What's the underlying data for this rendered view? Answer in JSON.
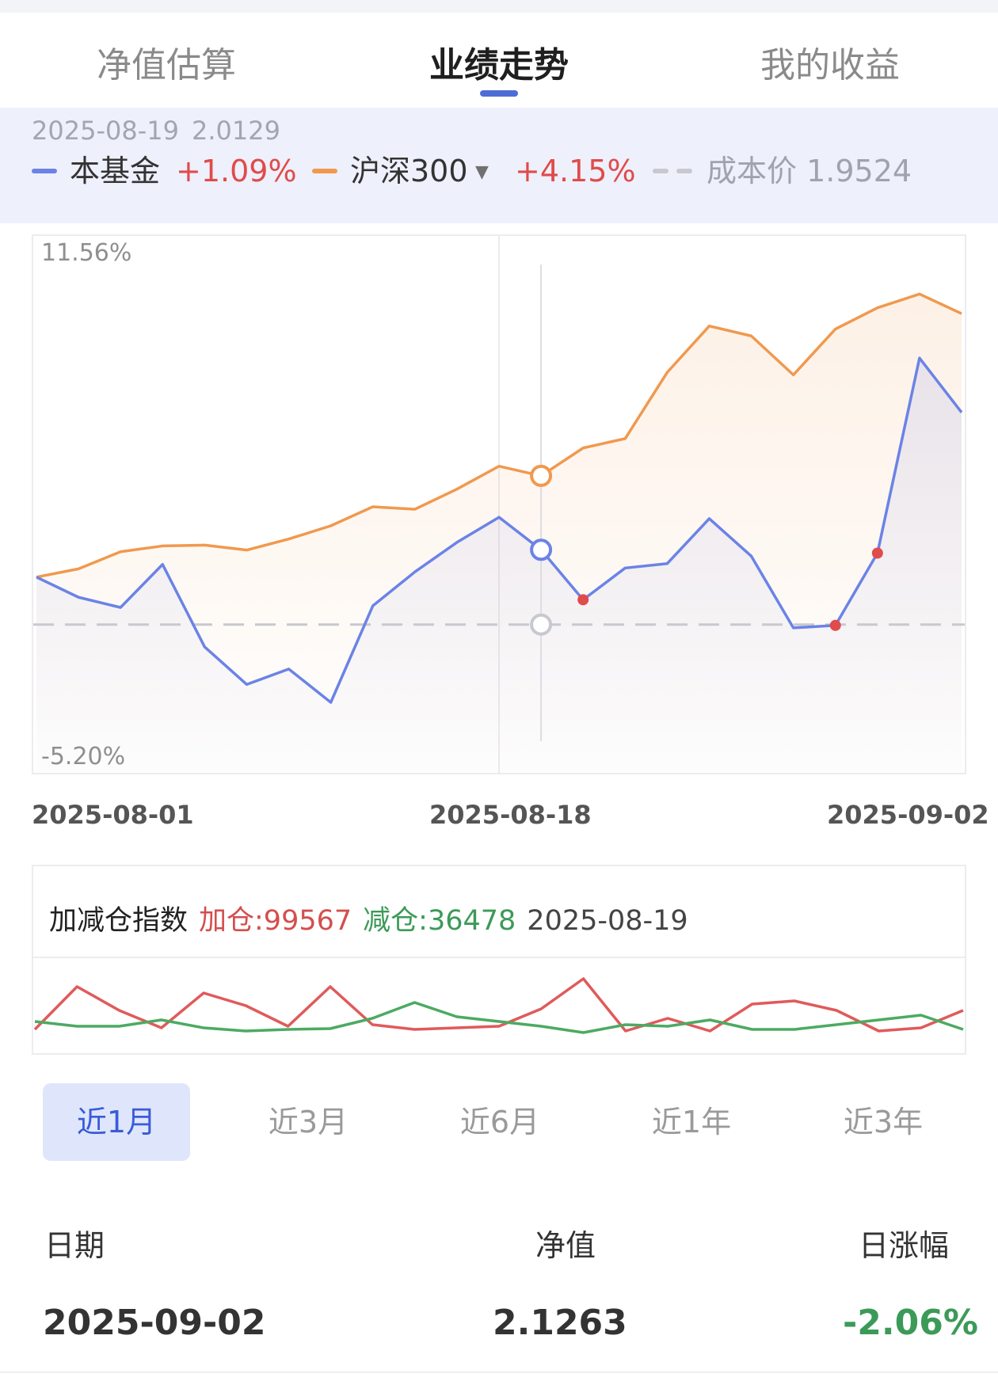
{
  "tabs": [
    {
      "label": "净值估算"
    },
    {
      "label": "业绩走势",
      "active": true
    },
    {
      "label": "我的收益"
    }
  ],
  "legend": {
    "date": "2025-08-19",
    "nav": "2.0129",
    "fund_label": "本基金",
    "fund_change": "+1.09%",
    "index_label": "沪深300",
    "index_change": "+4.15%",
    "cost_label": "成本价 1.9524",
    "colors": {
      "fund": "#6b83e6",
      "index": "#f0994e",
      "cost": "#c8c8d0",
      "positive": "#e04b4b",
      "negative": "#3c9a58"
    }
  },
  "chart_data": [
    {
      "type": "line",
      "ylim": [
        -5.2,
        11.56
      ],
      "y_tick_labels": [
        "11.56%",
        "-5.20%"
      ],
      "x_tick_labels": [
        "2025-08-01",
        "2025-08-18",
        "2025-09-02"
      ],
      "x": [
        "08-01",
        "08-04",
        "08-05",
        "08-06",
        "08-07",
        "08-08",
        "08-11",
        "08-12",
        "08-13",
        "08-14",
        "08-15",
        "08-18",
        "08-19",
        "08-20",
        "08-21",
        "08-22",
        "08-25",
        "08-26",
        "08-27",
        "08-28",
        "08-29",
        "09-01",
        "09-02"
      ],
      "series": [
        {
          "name": "本基金",
          "color": "#6b83e6",
          "values": [
            0.0,
            -0.73,
            -1.1,
            0.46,
            -2.53,
            -3.89,
            -3.33,
            -4.54,
            -1.04,
            0.19,
            1.26,
            2.17,
            0.99,
            -0.82,
            0.33,
            0.49,
            2.12,
            0.76,
            -1.84,
            -1.75,
            0.87,
            7.94,
            5.97
          ]
        },
        {
          "name": "沪深300",
          "color": "#f0994e",
          "values": [
            0.0,
            0.3,
            0.92,
            1.13,
            1.16,
            0.98,
            1.38,
            1.86,
            2.55,
            2.46,
            3.19,
            4.02,
            3.67,
            4.68,
            5.02,
            7.42,
            9.1,
            8.74,
            7.33,
            8.99,
            9.76,
            10.26,
            9.55
          ]
        }
      ],
      "cost_line": {
        "name": "成本价",
        "value": -1.72,
        "color": "#c8c8d0"
      },
      "highlight": {
        "x": "08-19",
        "fund": 0.99,
        "index": 3.67
      },
      "red_markers": [
        "08-20",
        "08-28",
        "08-29"
      ],
      "grid": false
    },
    {
      "type": "line",
      "title": "加减仓指数",
      "ylim": [
        0,
        100
      ],
      "series": [
        {
          "name": "加仓",
          "color": "#e05a5a",
          "values": [
            18,
            72,
            42,
            20,
            64,
            48,
            22,
            72,
            24,
            18,
            20,
            22,
            44,
            82,
            16,
            32,
            16,
            50,
            54,
            42,
            16,
            20,
            42
          ]
        },
        {
          "name": "减仓",
          "color": "#4caa62",
          "values": [
            28,
            22,
            22,
            30,
            20,
            16,
            18,
            19,
            32,
            52,
            34,
            28,
            22,
            14,
            24,
            22,
            30,
            18,
            18,
            24,
            30,
            36,
            18
          ]
        }
      ]
    }
  ],
  "index_box": {
    "title": "加减仓指数",
    "add_text": "加仓:99567",
    "reduce_text": "减仓:36478",
    "date": "2025-08-19"
  },
  "periods": [
    {
      "label": "近1月",
      "active": true
    },
    {
      "label": "近3月"
    },
    {
      "label": "近6月"
    },
    {
      "label": "近1年"
    },
    {
      "label": "近3年"
    }
  ],
  "table": {
    "headers": [
      "日期",
      "净值",
      "日涨幅"
    ],
    "rows": [
      [
        "2025-09-02",
        "2.1263",
        "-2.06%"
      ]
    ]
  }
}
